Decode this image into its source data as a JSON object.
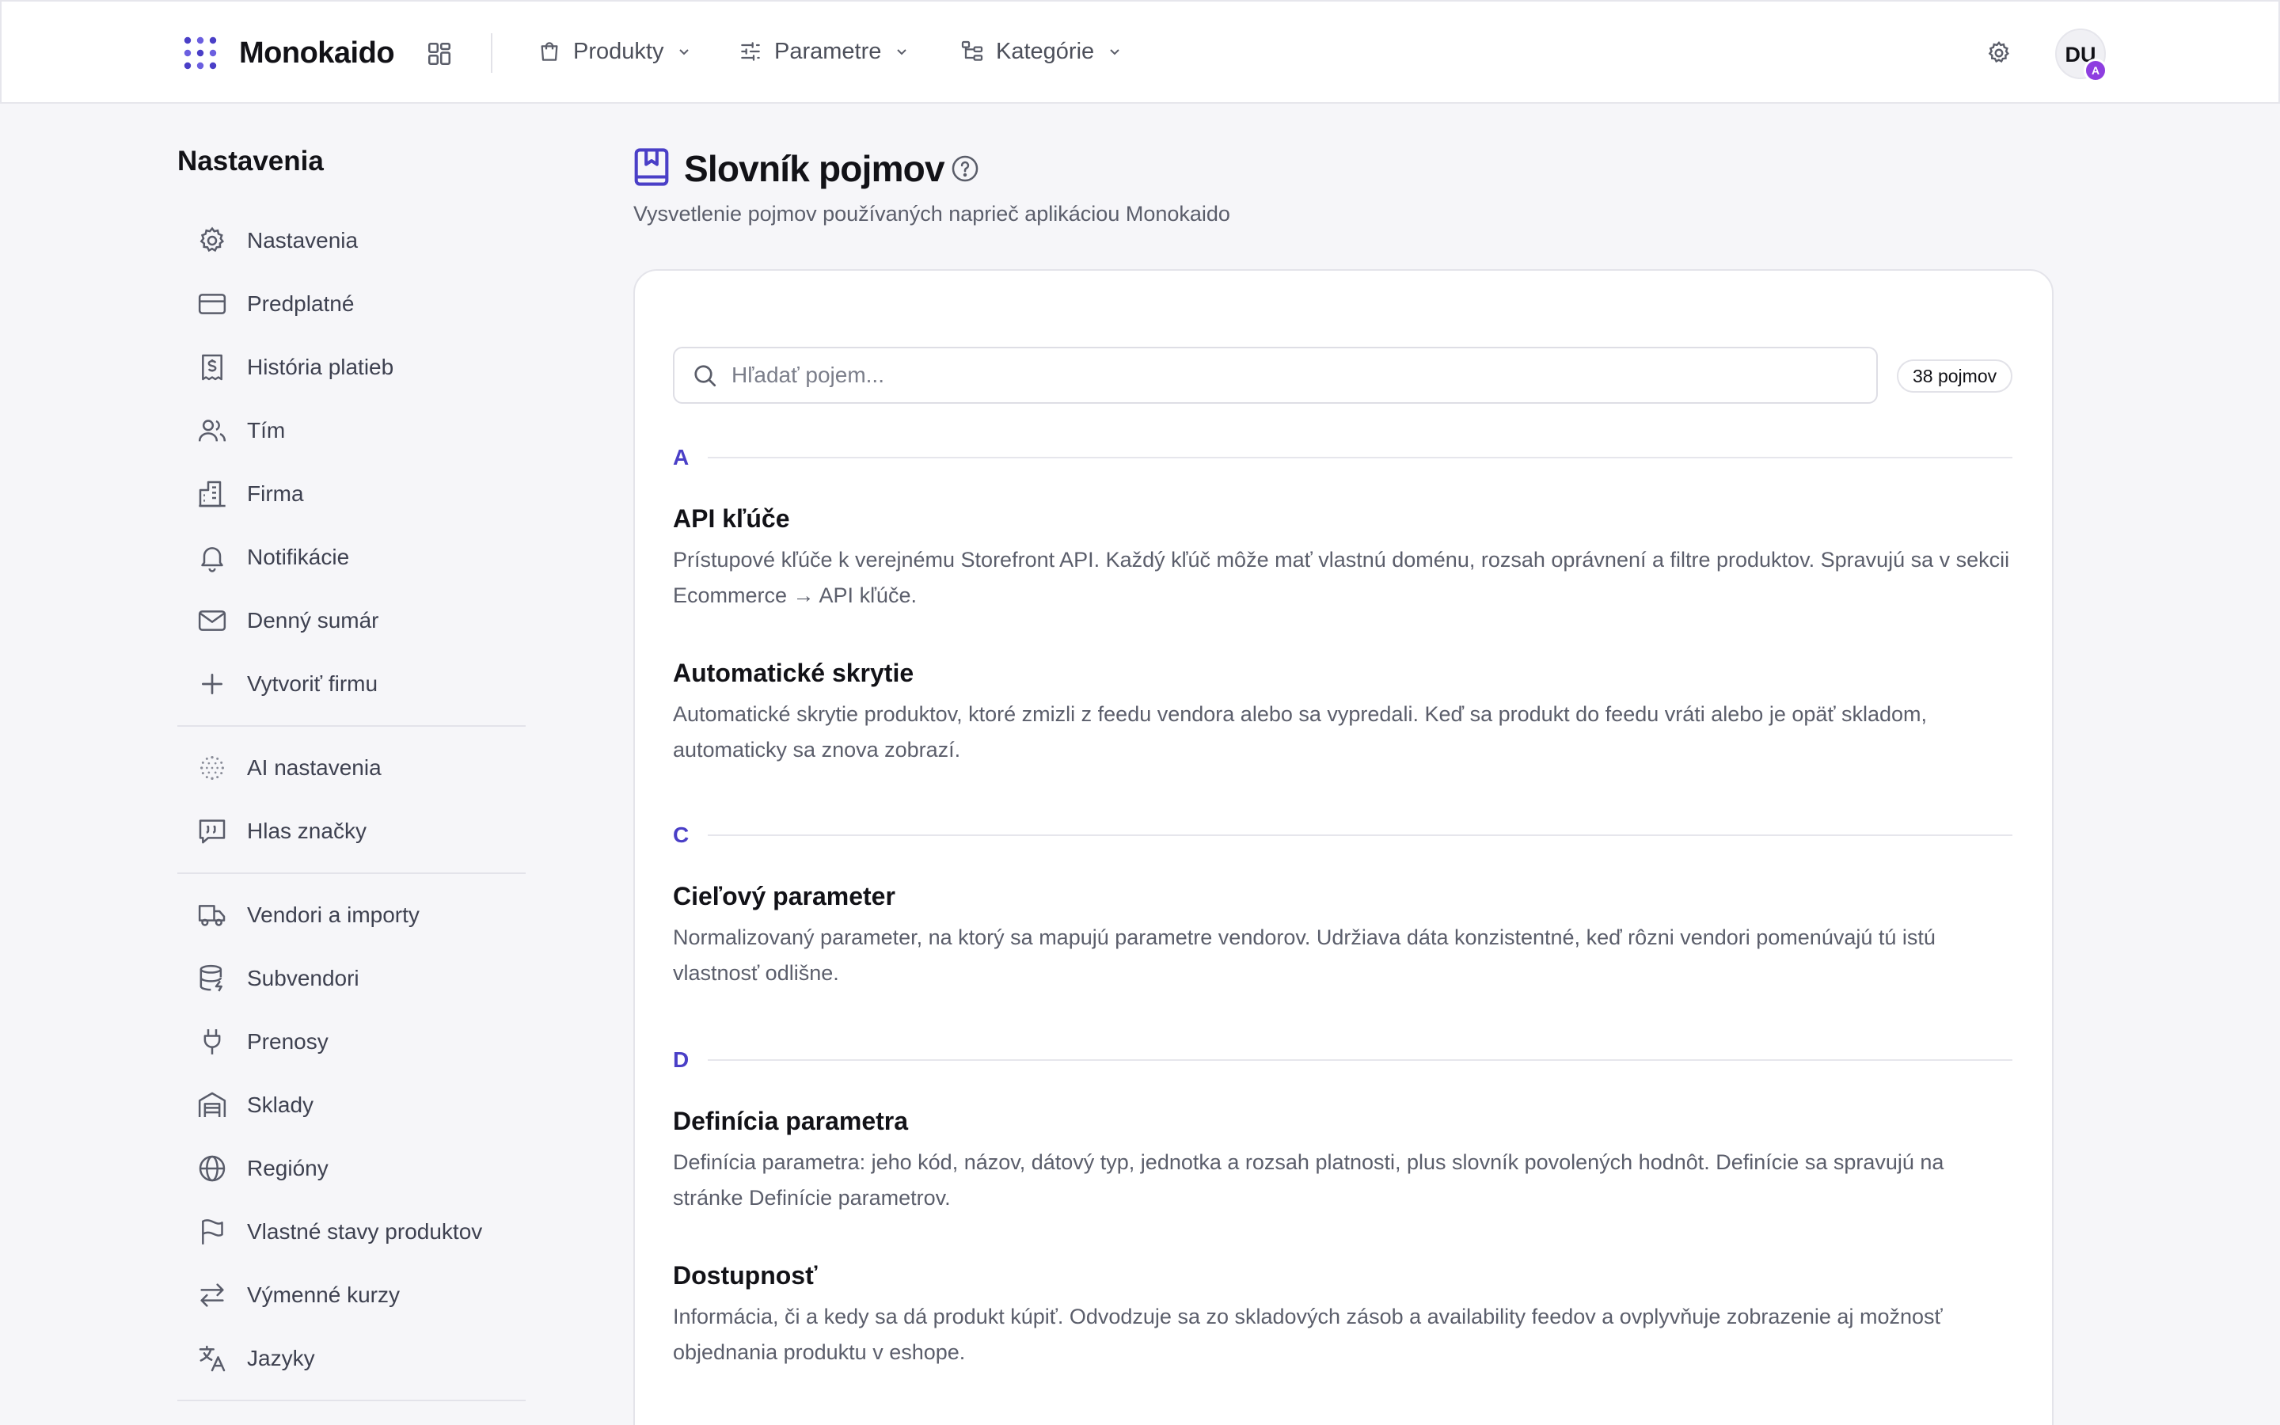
{
  "brand": {
    "name": "Monokaido",
    "accent": "#4a3fc7"
  },
  "topnav": {
    "menus": [
      {
        "label": "Produkty",
        "icon": "shopping-bag-icon"
      },
      {
        "label": "Parametre",
        "icon": "sliders-icon"
      },
      {
        "label": "Kategórie",
        "icon": "hierarchy-icon"
      }
    ],
    "user": {
      "initials": "DU",
      "badge": "A",
      "badge_color": "#8e3ee0"
    }
  },
  "sidebar": {
    "title": "Nastavenia",
    "groups": [
      [
        {
          "label": "Nastavenia",
          "icon": "gear-icon"
        },
        {
          "label": "Predplatné",
          "icon": "credit-card-icon"
        },
        {
          "label": "História platieb",
          "icon": "receipt-icon"
        },
        {
          "label": "Tím",
          "icon": "users-icon"
        },
        {
          "label": "Firma",
          "icon": "building-icon"
        },
        {
          "label": "Notifikácie",
          "icon": "bell-icon"
        },
        {
          "label": "Denný sumár",
          "icon": "mail-icon"
        },
        {
          "label": "Vytvoriť firmu",
          "icon": "plus-icon"
        }
      ],
      [
        {
          "label": "AI nastavenia",
          "icon": "ai-sparkle-icon"
        },
        {
          "label": "Hlas značky",
          "icon": "quote-message-icon"
        }
      ],
      [
        {
          "label": "Vendori a importy",
          "icon": "truck-icon"
        },
        {
          "label": "Subvendori",
          "icon": "database-icon"
        },
        {
          "label": "Prenosy",
          "icon": "plug-icon"
        },
        {
          "label": "Sklady",
          "icon": "warehouse-icon"
        },
        {
          "label": "Regióny",
          "icon": "globe-icon"
        },
        {
          "label": "Vlastné stavy produktov",
          "icon": "flag-icon"
        },
        {
          "label": "Výmenné kurzy",
          "icon": "exchange-arrows-icon"
        },
        {
          "label": "Jazyky",
          "icon": "translate-icon"
        }
      ]
    ]
  },
  "page": {
    "title": "Slovník pojmov",
    "subtitle": "Vysvetlenie pojmov používaných naprieč aplikáciou Monokaido",
    "search_placeholder": "Hľadať pojem...",
    "search_value": "",
    "count_label": "38 pojmov"
  },
  "glossary": [
    {
      "letter": "A",
      "terms": [
        {
          "title": "API kľúče",
          "description": "Prístupové kľúče k verejnému Storefront API. Každý kľúč môže mať vlastnú doménu, rozsah oprávnení a filtre produktov. Spravujú sa v sekcii Ecommerce → API kľúče."
        },
        {
          "title": "Automatické skrytie",
          "description": "Automatické skrytie produktov, ktoré zmizli z feedu vendora alebo sa vypredali. Keď sa produkt do feedu vráti alebo je opäť skladom, automaticky sa znova zobrazí."
        }
      ]
    },
    {
      "letter": "C",
      "terms": [
        {
          "title": "Cieľový parameter",
          "description": "Normalizovaný parameter, na ktorý sa mapujú parametre vendorov. Udržiava dáta konzistentné, keď rôzni vendori pomenúvajú tú istú vlastnosť odlišne."
        }
      ]
    },
    {
      "letter": "D",
      "terms": [
        {
          "title": "Definícia parametra",
          "description": "Definícia parametra: jeho kód, názov, dátový typ, jednotka a rozsah platnosti, plus slovník povolených hodnôt. Definície sa spravujú na stránke Definície parametrov."
        },
        {
          "title": "Dostupnosť",
          "description": "Informácia, či a kedy sa dá produkt kúpiť. Odvodzuje sa zo skladových zásob a availability feedov a ovplyvňuje zobrazenie aj možnosť objednania produktu v eshope."
        }
      ]
    }
  ]
}
